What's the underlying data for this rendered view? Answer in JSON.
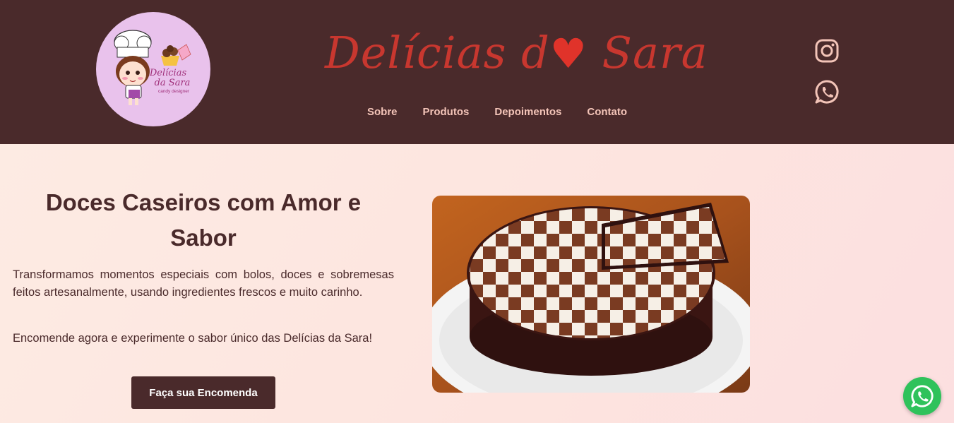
{
  "header": {
    "brand_prefix": "Delícias d",
    "brand_heart": "♥",
    "brand_suffix": " Sara",
    "logo": {
      "line1": "Delícias",
      "line2": "da Sara",
      "tagline": "candy designer",
      "icon": "chef-girl-logo"
    },
    "nav": [
      {
        "label": "Sobre"
      },
      {
        "label": "Produtos"
      },
      {
        "label": "Depoimentos"
      },
      {
        "label": "Contato"
      }
    ],
    "social": [
      {
        "icon": "instagram-icon"
      },
      {
        "icon": "whatsapp-icon"
      }
    ]
  },
  "hero": {
    "title": "Doces Caseiros com Amor e Sabor",
    "paragraph1": "Transformamos momentos especiais com bolos, doces e sobremesas feitos artesanalmente, usando ingredientes frescos e muito carinho.",
    "paragraph2": "Encomende agora e experimente o sabor único das Delícias da Sara!",
    "cta_label": "Faça sua Encomenda",
    "image": "checkerboard-cake-photo"
  },
  "floating": {
    "icon": "whatsapp-icon"
  },
  "colors": {
    "header_bg": "#4a2a2b",
    "brand": "#c8372f",
    "nav_text": "#f3c4b8",
    "hero_bg": "#fde8e1",
    "button_bg": "#4a2a2b",
    "whatsapp": "#2fc25b"
  }
}
